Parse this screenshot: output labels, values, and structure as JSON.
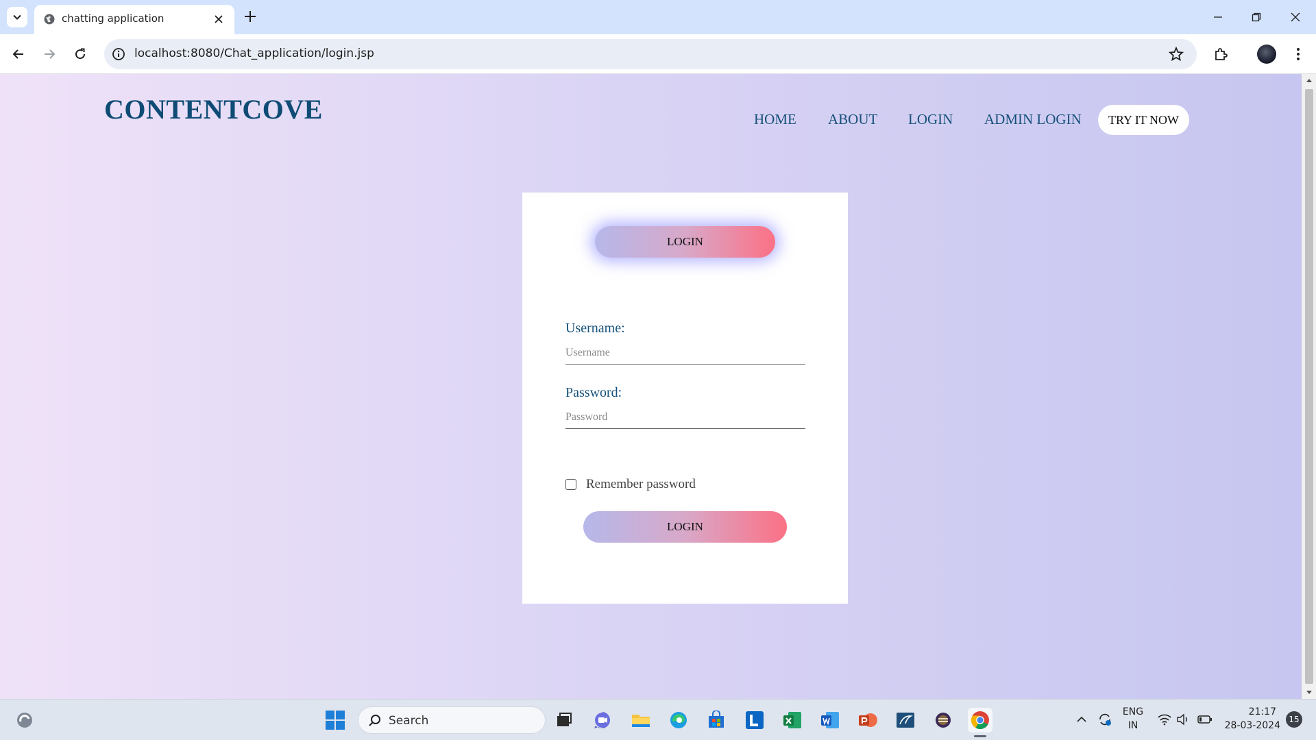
{
  "browser": {
    "tab_title": "chatting application",
    "url": "localhost:8080/Chat_application/login.jsp"
  },
  "site": {
    "brand": "CONTENTCOVE",
    "nav": {
      "home": "HOME",
      "about": "ABOUT",
      "login": "LOGIN",
      "admin_login": "ADMIN LOGIN",
      "try_it_now": "TRY IT NOW"
    }
  },
  "login_card": {
    "header_button": "LOGIN",
    "username_label": "Username:",
    "username_placeholder": "Username",
    "password_label": "Password:",
    "password_placeholder": "Password",
    "remember_label": "Remember password",
    "submit_button": "LOGIN"
  },
  "taskbar": {
    "search_label": "Search",
    "language": "ENG",
    "region": "IN",
    "time": "21:17",
    "date": "28-03-2024",
    "notifications": "15",
    "apps": [
      "file-explorer-window",
      "teams-meet",
      "file-explorer",
      "edge",
      "microsoft-store",
      "l-app",
      "excel",
      "word",
      "powerpoint",
      "sql-app",
      "eclipse",
      "chrome"
    ]
  }
}
